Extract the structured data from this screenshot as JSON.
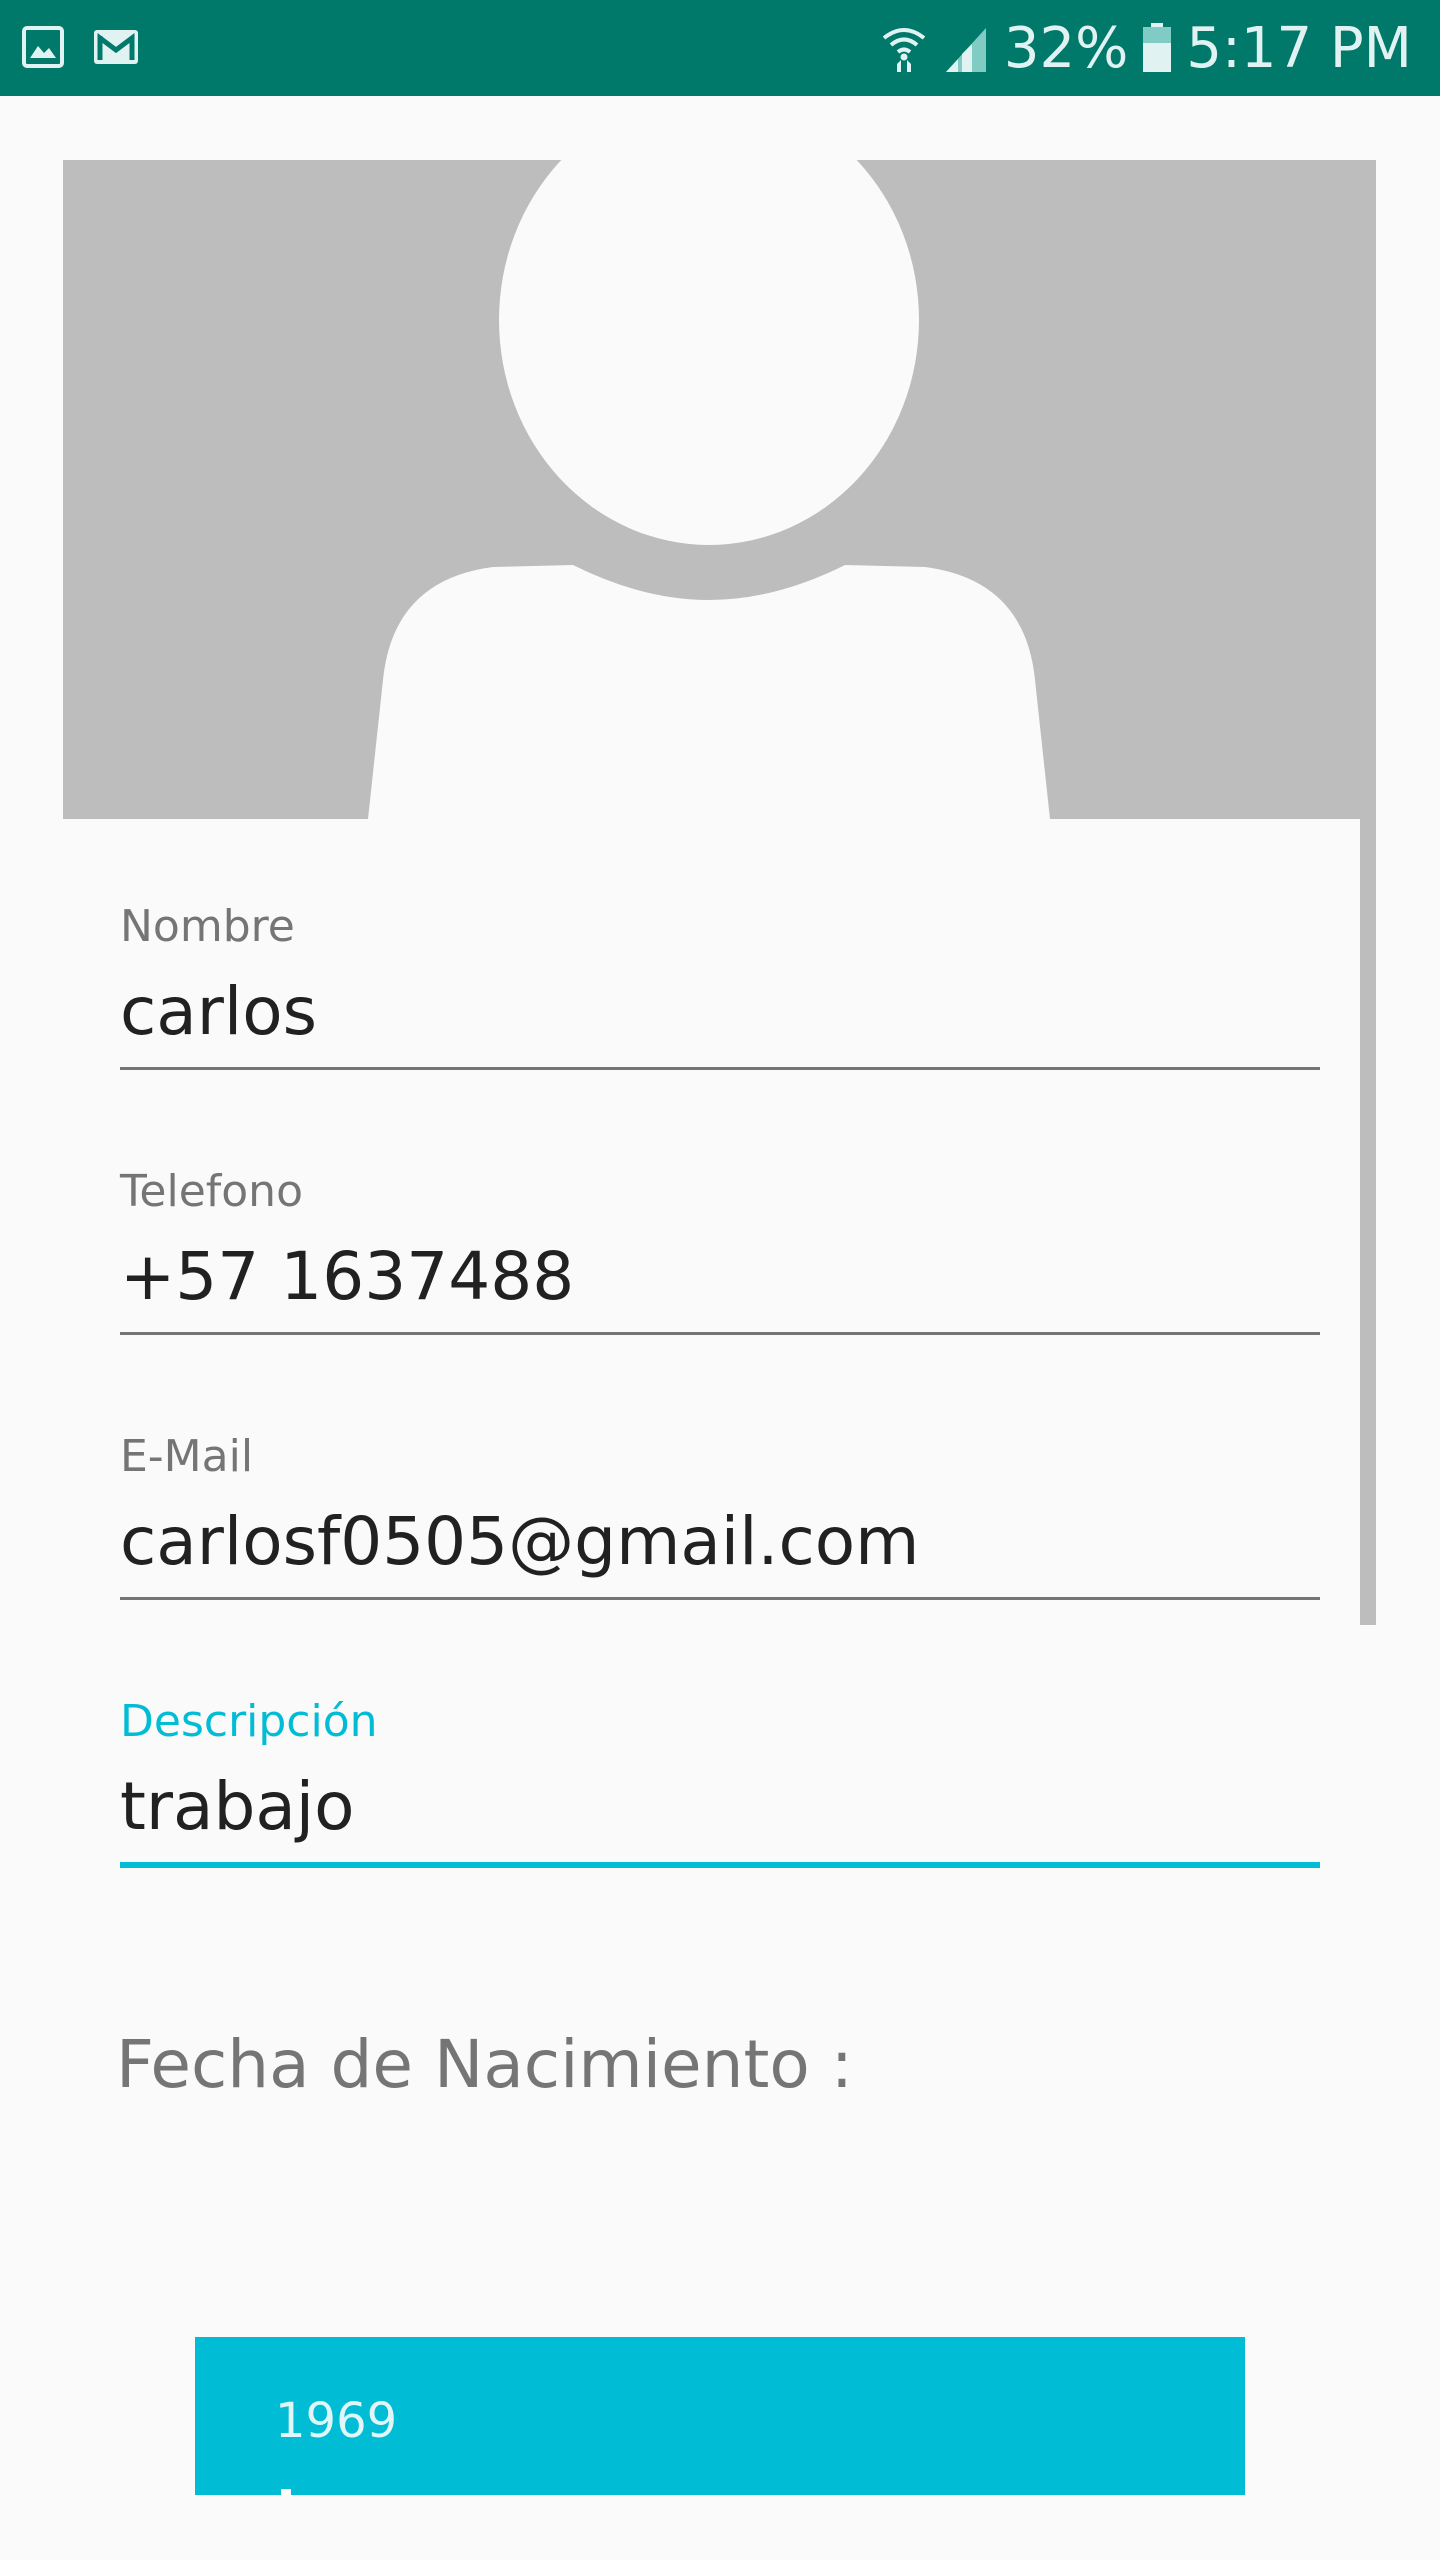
{
  "status_bar": {
    "left_icons": [
      "gallery-icon",
      "gmail-icon"
    ],
    "battery": "32%",
    "time": "5:17 PM"
  },
  "form": {
    "nombre": {
      "label": "Nombre",
      "value": "carlos"
    },
    "telefono": {
      "label": "Telefono",
      "value": "+57 1637488"
    },
    "email": {
      "label": "E-Mail",
      "value": "carlosf0505@gmail.com"
    },
    "descripcion": {
      "label": "Descripción",
      "value": "trabajo"
    }
  },
  "birth_date": {
    "label": "Fecha de Nacimiento :",
    "year": "1969"
  },
  "colors": {
    "status_bar": "#00796b",
    "accent": "#00bcd4",
    "background": "#fafafa",
    "placeholder_gray": "#bdbdbd"
  }
}
